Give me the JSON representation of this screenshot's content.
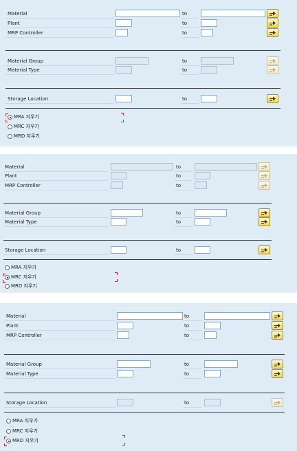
{
  "screens": [
    {
      "rows": [
        {
          "label": "Material",
          "to": "to",
          "from_disabled": false,
          "to_disabled": false,
          "button_disabled": false
        },
        {
          "label": "Plant",
          "to": "to",
          "from_disabled": false,
          "to_disabled": false,
          "button_disabled": false
        },
        {
          "label": "MRP Controller",
          "to": "to",
          "from_disabled": false,
          "to_disabled": false,
          "button_disabled": false
        },
        {
          "label": "Material Group",
          "to": "to",
          "from_disabled": true,
          "to_disabled": true,
          "button_disabled": true
        },
        {
          "label": "Material Type",
          "to": "to",
          "from_disabled": true,
          "to_disabled": true,
          "button_disabled": true
        },
        {
          "label": "Storage Location",
          "to": "to",
          "from_disabled": false,
          "to_disabled": false,
          "button_disabled": false
        }
      ],
      "radios": [
        {
          "label": "MRA 지우기",
          "selected": true
        },
        {
          "label": "MRC 지우기",
          "selected": false
        },
        {
          "label": "MRD 지우기",
          "selected": false
        }
      ]
    },
    {
      "rows": [
        {
          "label": "Material",
          "to": "to",
          "from_disabled": true,
          "to_disabled": true,
          "button_disabled": true
        },
        {
          "label": "Plant",
          "to": "to",
          "from_disabled": true,
          "to_disabled": true,
          "button_disabled": true
        },
        {
          "label": "MRP Controller",
          "to": "to",
          "from_disabled": true,
          "to_disabled": true,
          "button_disabled": true
        },
        {
          "label": "Material Group",
          "to": "to",
          "from_disabled": false,
          "to_disabled": false,
          "button_disabled": false
        },
        {
          "label": "Material Type",
          "to": "to",
          "from_disabled": false,
          "to_disabled": false,
          "button_disabled": false
        },
        {
          "label": "Storage Location",
          "to": "to",
          "from_disabled": false,
          "to_disabled": false,
          "button_disabled": false
        }
      ],
      "radios": [
        {
          "label": "MRA 지우기",
          "selected": false
        },
        {
          "label": "MRC 지우기",
          "selected": true
        },
        {
          "label": "MRD 지우기",
          "selected": false
        }
      ]
    },
    {
      "rows": [
        {
          "label": "Material",
          "to": "to",
          "from_disabled": false,
          "to_disabled": false,
          "button_disabled": false
        },
        {
          "label": "Plant",
          "to": "to",
          "from_disabled": false,
          "to_disabled": false,
          "button_disabled": false
        },
        {
          "label": "MRP Controller",
          "to": "to",
          "from_disabled": false,
          "to_disabled": false,
          "button_disabled": false
        },
        {
          "label": "Material Group",
          "to": "to",
          "from_disabled": false,
          "to_disabled": false,
          "button_disabled": false
        },
        {
          "label": "Material Type",
          "to": "to",
          "from_disabled": false,
          "to_disabled": false,
          "button_disabled": false
        },
        {
          "label": "Storage Location",
          "to": "to",
          "from_disabled": true,
          "to_disabled": true,
          "button_disabled": true
        }
      ],
      "radios": [
        {
          "label": "MRA 지우기",
          "selected": false
        },
        {
          "label": "MRC 지우기",
          "selected": false
        },
        {
          "label": "MRD 지우기",
          "selected": true
        }
      ]
    }
  ],
  "icons": {
    "multiple_selection": "multiple-selection-arrow-icon"
  },
  "colors": {
    "panel_background": "#dfebf5",
    "button_yellow": "#f0d763",
    "focus_marker": "#d4243a"
  }
}
